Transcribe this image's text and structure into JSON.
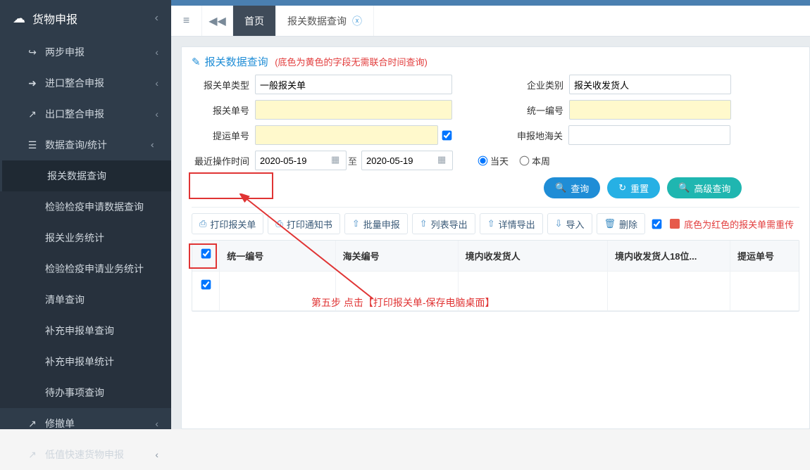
{
  "sidebar": {
    "header": {
      "label": "货物申报"
    },
    "items": [
      {
        "label": "两步申报",
        "glyph": "↪",
        "expandable": true
      },
      {
        "label": "进口整合申报",
        "glyph": "➜",
        "expandable": true
      },
      {
        "label": "出口整合申报",
        "glyph": "↗",
        "expandable": true
      },
      {
        "label": "数据查询/统计",
        "glyph": "☰",
        "expandable": true,
        "open": true,
        "sub": [
          {
            "label": "报关数据查询",
            "active": true
          },
          {
            "label": "检验检疫申请数据查询"
          },
          {
            "label": "报关业务统计"
          },
          {
            "label": "检验检疫申请业务统计"
          },
          {
            "label": "清单查询"
          },
          {
            "label": "补充申报单查询"
          },
          {
            "label": "补充申报单统计"
          },
          {
            "label": "待办事项查询"
          }
        ]
      },
      {
        "label": "修撤单",
        "glyph": "↗",
        "expandable": true
      },
      {
        "label": "低值快速货物申报",
        "glyph": "↗",
        "expandable": true
      }
    ]
  },
  "tabs": {
    "controls": {
      "menu": "≡",
      "back": "◀◀"
    },
    "home": "首页",
    "items": [
      {
        "label": "报关数据查询"
      }
    ]
  },
  "panel": {
    "title": "报关数据查询",
    "note": "(底色为黄色的字段无需联合时间查询)"
  },
  "form": {
    "decl_type": {
      "label": "报关单类型",
      "value": "一般报关单"
    },
    "ent_type": {
      "label": "企业类别",
      "value": "报关收发货人"
    },
    "decl_no": {
      "label": "报关单号",
      "value": ""
    },
    "unified_no": {
      "label": "统一编号",
      "value": ""
    },
    "bl_no": {
      "label": "提运单号",
      "value": ""
    },
    "customs": {
      "label": "申报地海关",
      "value": ""
    },
    "last_op": {
      "label": "最近操作时间",
      "from": "2020-05-19",
      "to": "2020-05-19",
      "sep": "至"
    },
    "radio": {
      "today": "当天",
      "week": "本周"
    }
  },
  "buttons": {
    "search": "查询",
    "reset": "重置",
    "advanced": "高级查询"
  },
  "toolbar": {
    "print_decl": "打印报关单",
    "print_notice": "打印通知书",
    "batch_decl": "批量申报",
    "list_export": "列表导出",
    "detail_export": "详情导出",
    "import": "导入",
    "delete": "删除",
    "note": "底色为红色的报关单需重传"
  },
  "table": {
    "headers": {
      "unified_no": "统一编号",
      "customs_no": "海关编号",
      "domestic_consignee": "境内收发货人",
      "domestic_consignee_18": "境内收发货人18位...",
      "bl_no": "提运单号"
    },
    "rows": [
      {
        "unified_no": "",
        "customs_no": "",
        "domestic_consignee": "",
        "domestic_consignee_18": "",
        "bl_no": ""
      }
    ]
  },
  "annotation": {
    "step5": "第五步 点击【打印报关单-保存电脑桌面】"
  }
}
